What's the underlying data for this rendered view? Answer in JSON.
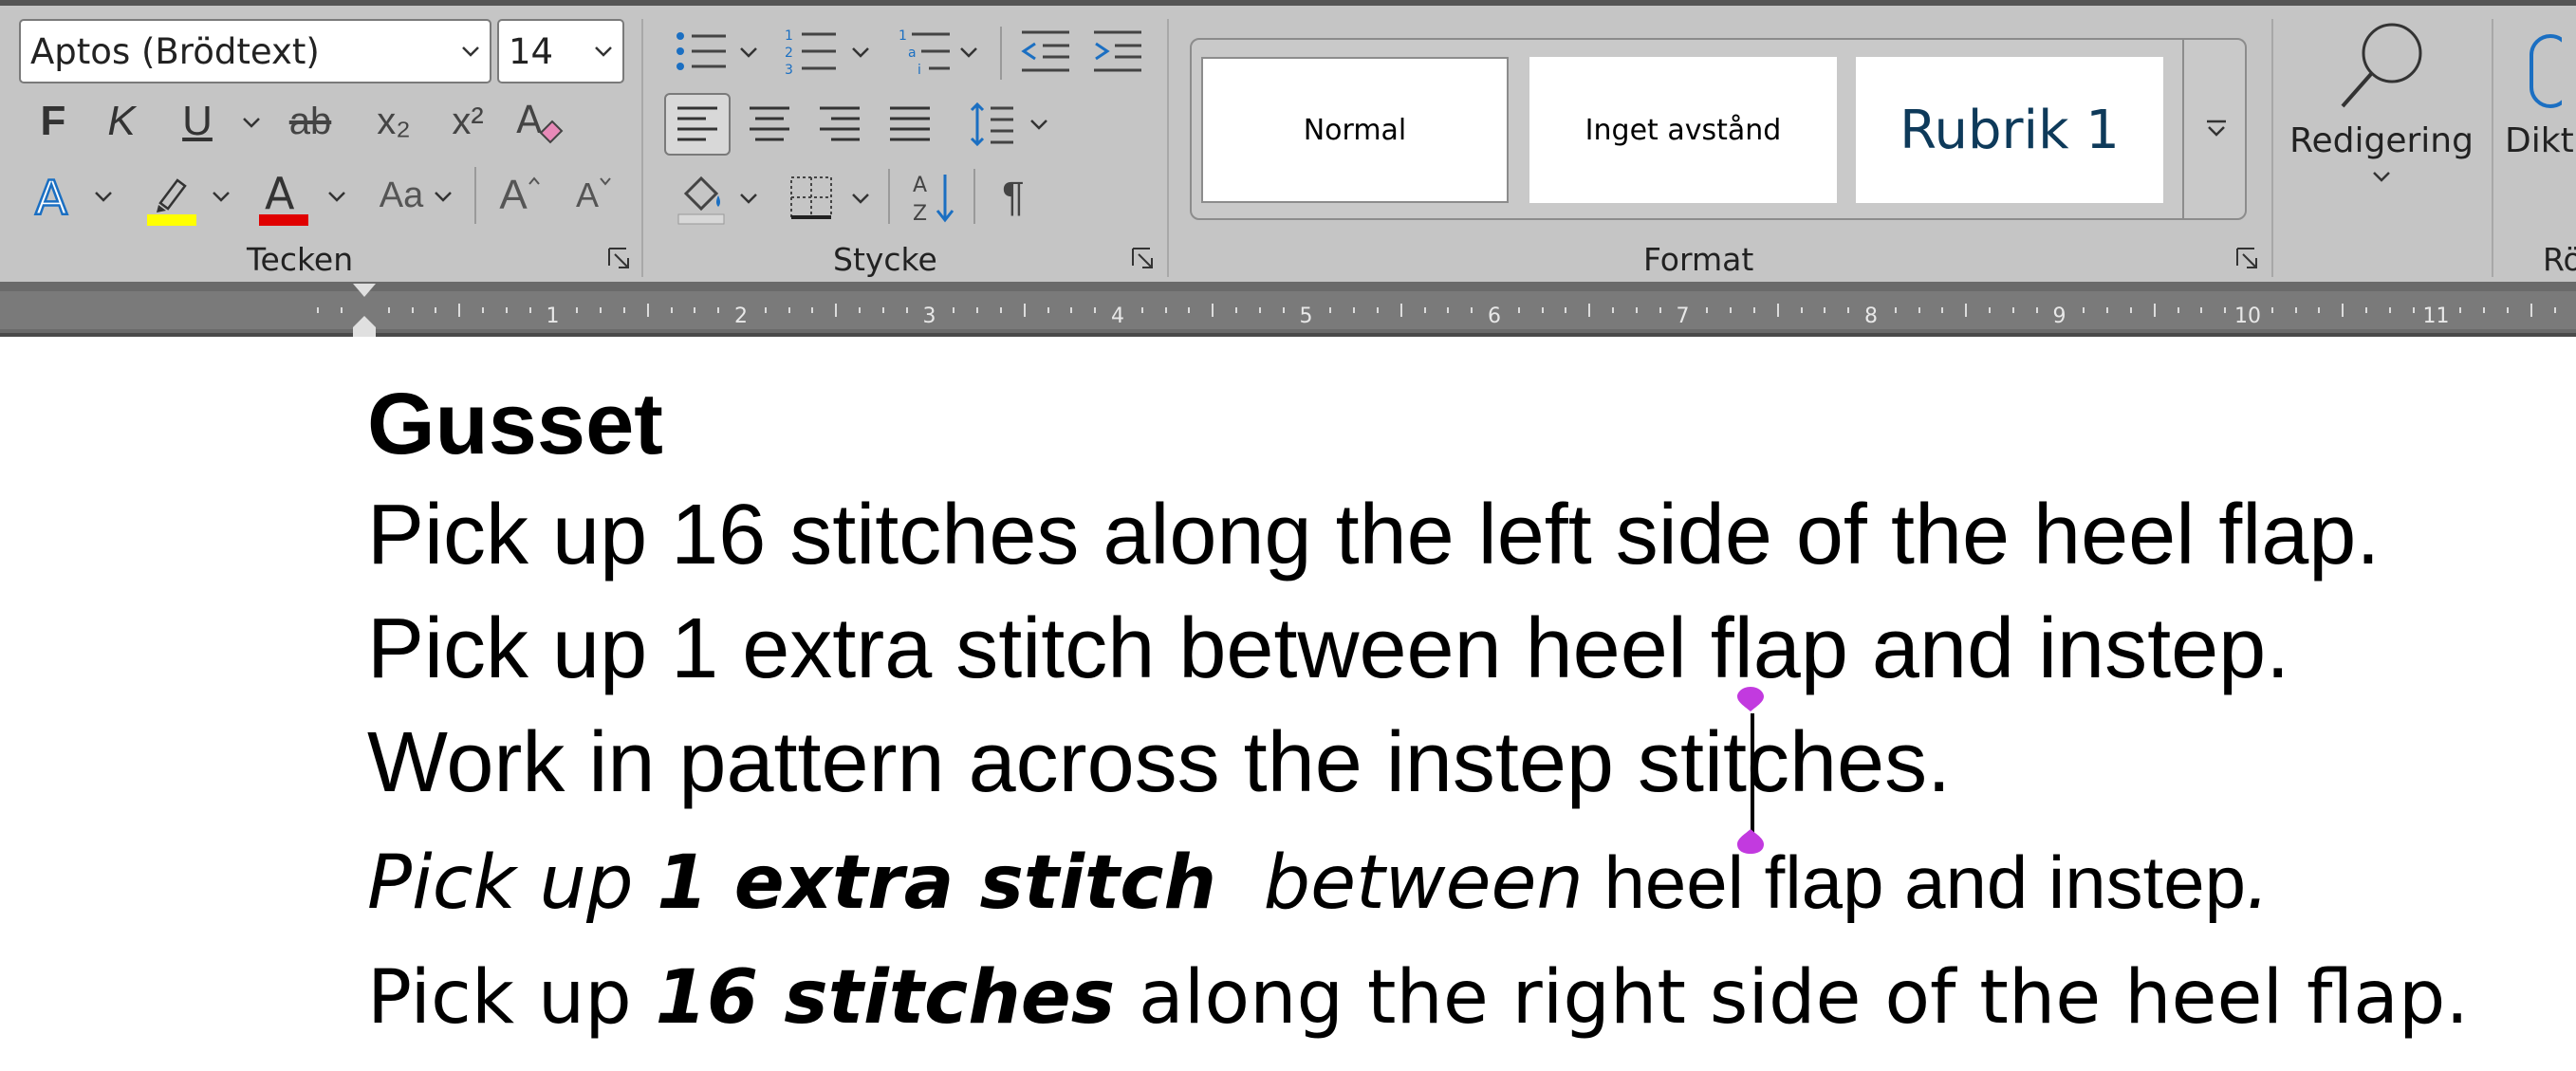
{
  "ribbon": {
    "font": {
      "name": "Aptos (Brödtext)",
      "size": "14",
      "bold_glyph": "F",
      "italic_glyph": "K",
      "underline_glyph": "U",
      "strike_glyph": "ab",
      "subscript_glyph": "x₂",
      "superscript_glyph": "x²",
      "case_glyph": "Aa",
      "grow_glyph": "A",
      "shrink_glyph": "A",
      "group_label": "Tecken"
    },
    "paragraph": {
      "group_label": "Stycke",
      "pilcrow_glyph": "¶"
    },
    "styles": {
      "group_label": "Format",
      "tiles": [
        "Normal",
        "Inget avstånd",
        "Rubrik 1"
      ],
      "heading_color": "#0e3a5a"
    },
    "editing": {
      "label": "Redigering"
    },
    "dictate": {
      "label": "Dikt",
      "group_label": "Rö"
    }
  },
  "ruler": {
    "numbers": [
      "1",
      "2",
      "3",
      "4",
      "5",
      "6",
      "7",
      "8",
      "9",
      "10",
      "11"
    ]
  },
  "document": {
    "heading": "Gusset",
    "line1": "Pick up 16 stitches along the left side of the heel flap.",
    "line2": "Pick up 1 extra stitch between heel flap and instep.",
    "line3": "Work in pattern across the instep stitches.",
    "line4": {
      "a": "Pick up ",
      "b": "1 extra stitch",
      "c": "  between",
      "d": " heel flap and instep",
      "e": "."
    },
    "line5": {
      "a": "Pick up ",
      "b": "16 stitches",
      "c": " along the right side of the heel flap."
    }
  },
  "colors": {
    "highlight": "#ffff00",
    "font_color": "#e00000",
    "handle": "#c23adf"
  }
}
